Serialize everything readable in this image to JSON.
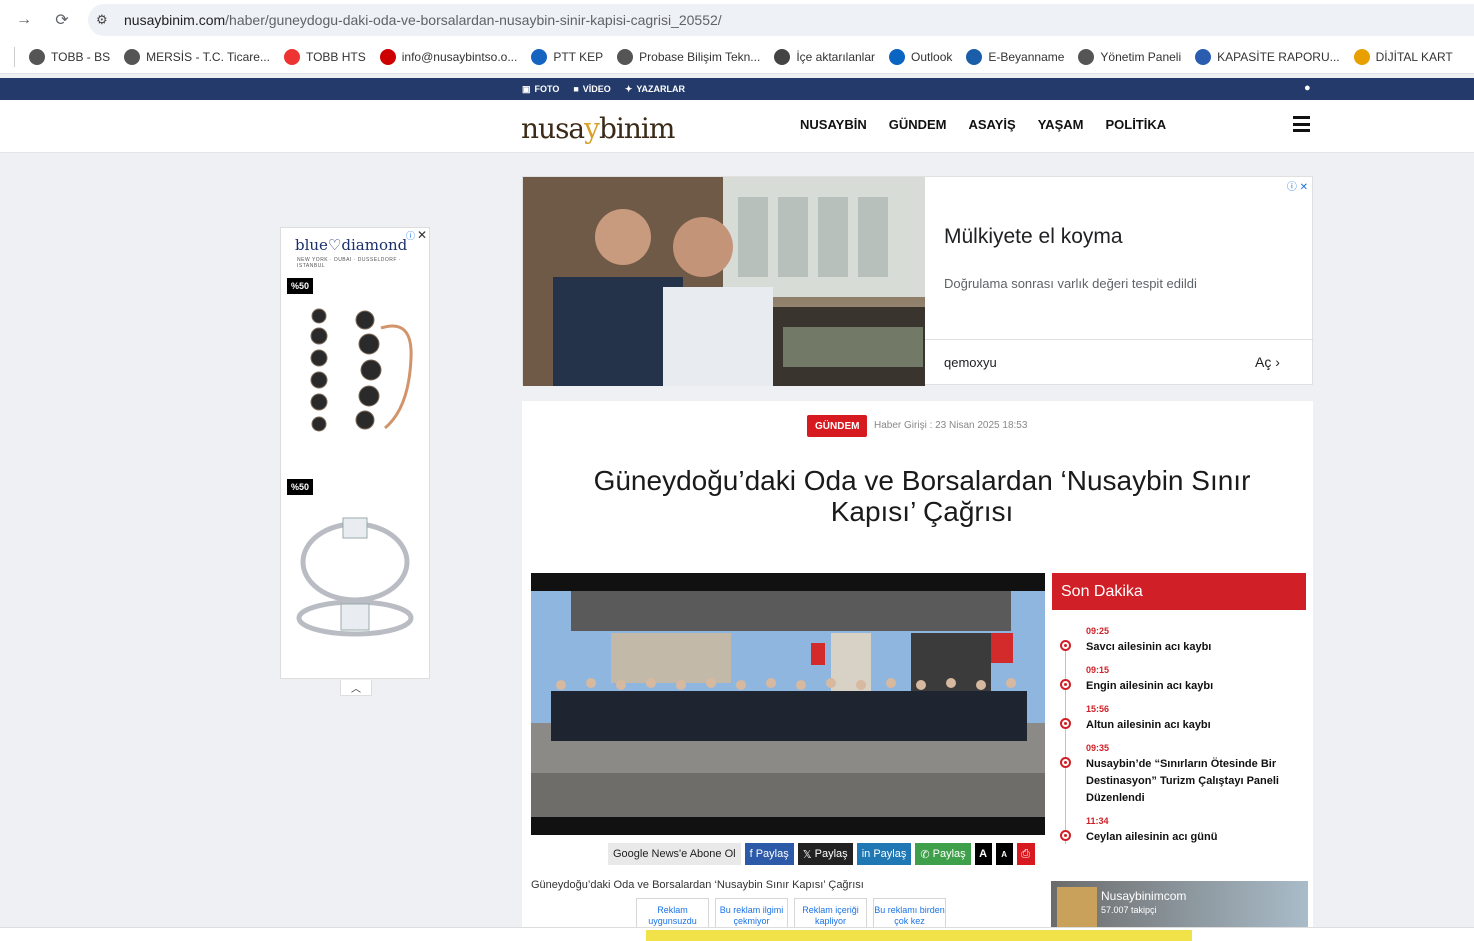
{
  "browser": {
    "url_host": "nusaybinim.com",
    "url_path": "/haber/guneydogu-daki-oda-ve-borsalardan-nusaybin-sinir-kapisi-cagrisi_20552/",
    "bookmarks": [
      {
        "label": "TOBB - BS",
        "color": "#555"
      },
      {
        "label": "MERSİS - T.C. Ticare...",
        "color": "#555"
      },
      {
        "label": "TOBB HTS",
        "color": "#e33"
      },
      {
        "label": "info@nusaybintso.o...",
        "color": "#c00"
      },
      {
        "label": "PTT KEP",
        "color": "#1565c0"
      },
      {
        "label": "Probase Bilişim Tekn...",
        "color": "#555"
      },
      {
        "label": "İçe aktarılanlar",
        "color": "#444"
      },
      {
        "label": "Outlook",
        "color": "#0a64c2"
      },
      {
        "label": "E-Beyanname",
        "color": "#1a5da8"
      },
      {
        "label": "Yönetim Paneli",
        "color": "#555"
      },
      {
        "label": "KAPASİTE RAPORU...",
        "color": "#2a5db0"
      },
      {
        "label": "DİJİTAL KART",
        "color": "#e8a000"
      }
    ]
  },
  "site": {
    "top_links": {
      "foto": "FOTO",
      "video": "VİDEO",
      "yazarlar": "YAZARLAR"
    },
    "logo": {
      "a": "nusa",
      "b": "y",
      "c": "binim"
    },
    "nav": [
      "NUSAYBİN",
      "GÜNDEM",
      "ASAYİŞ",
      "YAŞAM",
      "POLİTİKA"
    ]
  },
  "left_ad": {
    "brand": "blue♡diamond",
    "cities": "NEW YORK · DUBAI · DUSSELDORF · ISTANBUL",
    "discount1": "%50",
    "discount2": "%50"
  },
  "top_ad": {
    "headline": "Mülkiyete el koyma",
    "description": "Doğrulama sonrası varlık değeri tespit edildi",
    "advertiser": "qemoxyu",
    "cta": "Aç"
  },
  "article": {
    "category": "GÜNDEM",
    "date": "Haber Girişi : 23 Nisan 2025 18:53",
    "title": "Güneydoğu’daki Oda ve Borsalardan ‘Nusaybin Sınır Kapısı’ Çağrısı",
    "share": {
      "gnews": "Google News'e Abone Ol",
      "facebook": "Paylaş",
      "x": "Paylaş",
      "linkedin": "Paylaş",
      "whatsapp": "Paylaş",
      "font_big": "A",
      "font_small": "A"
    },
    "caption": "Güneydoğu’daki Oda ve Borsalardan ‘Nusaybin Sınır Kapısı’ Çağrısı",
    "ad_feedback": [
      "Reklam uygunsuzdu",
      "Bu reklam ilgimi çekmiyor",
      "Reklam içeriği kapliyor",
      "Bu reklamı birden çok kez"
    ]
  },
  "son_dakika": {
    "title": "Son Dakika",
    "items": [
      {
        "time": "09:25",
        "text": "Savcı ailesinin acı kaybı"
      },
      {
        "time": "09:15",
        "text": "Engin ailesinin acı kaybı"
      },
      {
        "time": "15:56",
        "text": "Altun ailesinin acı kaybı"
      },
      {
        "time": "09:35",
        "text": "Nusaybin’de “Sınırların Ötesinde Bir Destinasyon” Turizm Çalıştayı Paneli Düzenlendi"
      },
      {
        "time": "11:34",
        "text": "Ceylan ailesinin acı günü"
      }
    ]
  },
  "fb_widget": {
    "name": "Nusaybinimcom",
    "followers": "57.007 takipçi"
  }
}
